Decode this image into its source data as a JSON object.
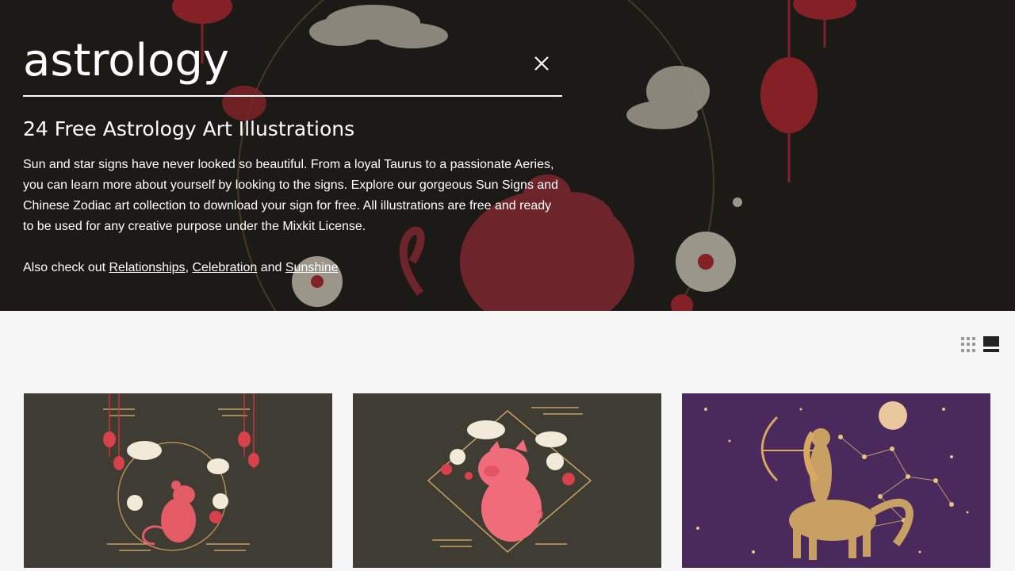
{
  "search": {
    "query": "astrology"
  },
  "hero": {
    "title": "24 Free Astrology Art Illustrations",
    "description": "Sun and star signs have never looked so beautiful. From a loyal Taurus to a passionate Aeries, you can learn more about yourself by looking to the signs. Explore our gorgeous Sun Signs and Chinese Zodiac art collection to download your sign for free. All illustrations are free and ready to be used for any creative purpose under the Mixkit License.",
    "also_prefix": "Also check out ",
    "links": [
      "Relationships",
      "Celebration",
      "Sunshine"
    ],
    "sep_comma": ", ",
    "sep_and": " and "
  },
  "cards": [
    {
      "subject": "rat-chinese-zodiac",
      "bg": "#3f3c33"
    },
    {
      "subject": "pig-chinese-zodiac",
      "bg": "#3f3c33"
    },
    {
      "subject": "sagittarius-centaur",
      "bg": "#4a2a5c"
    }
  ],
  "colors": {
    "accent_red": "#d8404a",
    "gold": "#c9a063",
    "cream": "#f1ead8"
  }
}
